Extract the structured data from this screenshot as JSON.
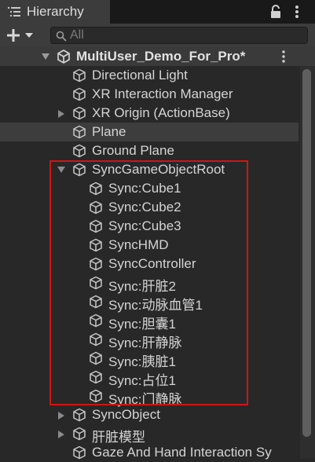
{
  "tab": {
    "title": "Hierarchy"
  },
  "search": {
    "placeholder": "All"
  },
  "scene": {
    "name": "MultiUser_Demo_For_Pro*"
  },
  "items": [
    {
      "label": "Directional Light",
      "icon": "cube-icon"
    },
    {
      "label": "XR Interaction Manager",
      "icon": "cube-icon"
    },
    {
      "label": "XR Origin (ActionBase)",
      "icon": "cube-icon",
      "fold": "collapsed"
    },
    {
      "label": "Plane",
      "icon": "cube-icon",
      "hover": true
    },
    {
      "label": "Ground Plane",
      "icon": "cube-icon"
    },
    {
      "label": "SyncGameObjectRoot",
      "icon": "cube-icon",
      "fold": "expanded"
    },
    {
      "label": "Sync:Cube1",
      "icon": "cube-icon"
    },
    {
      "label": "Sync:Cube2",
      "icon": "cube-icon"
    },
    {
      "label": "Sync:Cube3",
      "icon": "cube-icon"
    },
    {
      "label": "SyncHMD",
      "icon": "cube-icon"
    },
    {
      "label": "SyncController",
      "icon": "cube-icon"
    },
    {
      "label": "Sync:肝脏2",
      "icon": "cube-icon"
    },
    {
      "label": "Sync:动脉血管1",
      "icon": "cube-icon"
    },
    {
      "label": "Sync:胆囊1",
      "icon": "cube-icon"
    },
    {
      "label": "Sync:肝静脉",
      "icon": "cube-icon"
    },
    {
      "label": "Sync:胰脏1",
      "icon": "cube-icon"
    },
    {
      "label": "Sync:占位1",
      "icon": "cube-icon"
    },
    {
      "label": "Sync:门静脉",
      "icon": "cube-icon"
    },
    {
      "label": "SyncObject",
      "icon": "cube-icon",
      "fold": "collapsed"
    },
    {
      "label": "肝脏模型",
      "icon": "cube-icon",
      "fold": "collapsed"
    },
    {
      "label": "Gaze And Hand Interaction Sy",
      "icon": "cube-icon"
    }
  ],
  "colors": {
    "highlight": "#d21414",
    "background": "#282828"
  }
}
